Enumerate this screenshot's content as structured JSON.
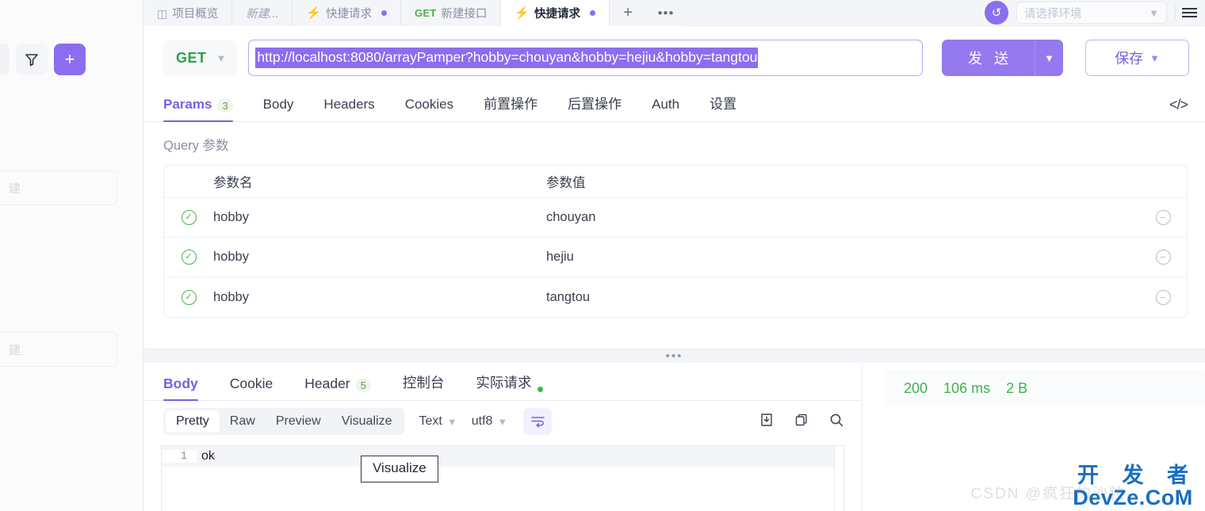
{
  "sidebar": {
    "filter_icon": "filter-icon",
    "add_label": "+",
    "ghost_items": [
      {
        "label": "建"
      },
      {
        "label": "建"
      }
    ]
  },
  "tabbar": {
    "tabs": [
      {
        "id": "overview",
        "icon": "layout-icon",
        "label": "项目概览",
        "method": "",
        "italic": false,
        "dot": false,
        "active": false
      },
      {
        "id": "new",
        "icon": "",
        "label": "新建...",
        "method": "",
        "italic": true,
        "dot": false,
        "active": false
      },
      {
        "id": "quick1",
        "icon": "bolt-icon",
        "label": "快捷请求",
        "method": "",
        "italic": false,
        "dot": true,
        "active": false
      },
      {
        "id": "newapi",
        "icon": "",
        "label": "新建接口",
        "method": "GET",
        "italic": false,
        "dot": false,
        "active": false
      },
      {
        "id": "quick2",
        "icon": "bolt-icon",
        "label": "快捷请求",
        "method": "",
        "italic": false,
        "dot": true,
        "active": true
      }
    ],
    "add_tab_label": "+",
    "more_tabs_label": "•••",
    "sync_icon": "sync-icon",
    "env_placeholder": "请选择环境",
    "menu_icon": "hamburger-menu-icon"
  },
  "request": {
    "method": "GET",
    "url": "http://localhost:8080/arrayPamper?hobby=chouyan&hobby=hejiu&hobby=tangtou",
    "url_selected": true,
    "send_label": "发 送",
    "save_label": "保存",
    "code_icon": "code-icon"
  },
  "request_tabs": [
    {
      "label": "Params",
      "badge": "3",
      "active": true
    },
    {
      "label": "Body",
      "badge": "",
      "active": false
    },
    {
      "label": "Headers",
      "badge": "",
      "active": false
    },
    {
      "label": "Cookies",
      "badge": "",
      "active": false
    },
    {
      "label": "前置操作",
      "badge": "",
      "active": false
    },
    {
      "label": "后置操作",
      "badge": "",
      "active": false
    },
    {
      "label": "Auth",
      "badge": "",
      "active": false
    },
    {
      "label": "设置",
      "badge": "",
      "active": false
    }
  ],
  "params": {
    "section_title": "Query 参数",
    "columns": {
      "name": "参数名",
      "value": "参数值"
    },
    "rows": [
      {
        "enabled": true,
        "name": "hobby",
        "value": "chouyan"
      },
      {
        "enabled": true,
        "name": "hobby",
        "value": "hejiu"
      },
      {
        "enabled": true,
        "name": "hobby",
        "value": "tangtou"
      }
    ]
  },
  "splitter": {
    "handle": "•••"
  },
  "response_tabs": [
    {
      "label": "Body",
      "badge": "",
      "dot": false,
      "active": true
    },
    {
      "label": "Cookie",
      "badge": "",
      "dot": false,
      "active": false
    },
    {
      "label": "Header",
      "badge": "5",
      "dot": false,
      "active": false
    },
    {
      "label": "控制台",
      "badge": "",
      "dot": false,
      "active": false
    },
    {
      "label": "实际请求",
      "badge": "",
      "dot": true,
      "active": false
    }
  ],
  "response_toolbar": {
    "segments": [
      {
        "label": "Pretty",
        "active": true
      },
      {
        "label": "Raw",
        "active": false
      },
      {
        "label": "Preview",
        "active": false
      },
      {
        "label": "Visualize",
        "active": false
      }
    ],
    "format_select": "Text",
    "encoding_select": "utf8",
    "wrap_icon": "word-wrap-icon",
    "download_icon": "download-icon",
    "copy_icon": "copy-icon",
    "search_icon": "search-icon"
  },
  "response_body": {
    "line_number": "1",
    "content": "ok"
  },
  "tooltip": {
    "text": "Visualize"
  },
  "status": {
    "code": "200",
    "time": "106 ms",
    "size": "2 B"
  },
  "watermark": {
    "top": "开 发 者",
    "bottom": "DevZe.CoM",
    "faint": "CSDN @疯狂的沙粒"
  },
  "colors": {
    "accent": "#8b6ef0",
    "method_get": "#26a544",
    "status_ok": "#3cb44a"
  }
}
